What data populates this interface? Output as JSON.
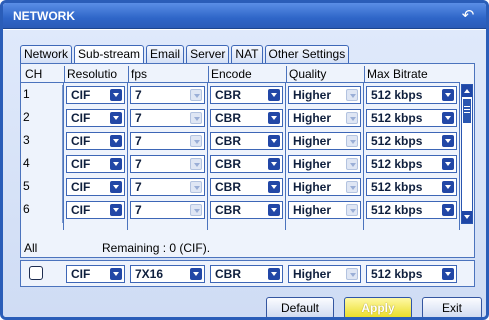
{
  "window": {
    "title": "NETWORK"
  },
  "tabs": [
    "Network",
    "Sub-stream",
    "Email",
    "Server",
    "NAT",
    "Other Settings"
  ],
  "active_tab": "Sub-stream",
  "table": {
    "headers": [
      "CH",
      "Resolutio",
      "fps",
      "Encode",
      "Quality",
      "Max Bitrate"
    ],
    "rows": [
      {
        "ch": "1",
        "resolution": "CIF",
        "fps": "7",
        "encode": "CBR",
        "quality": "Higher",
        "bitrate": "512 kbps"
      },
      {
        "ch": "2",
        "resolution": "CIF",
        "fps": "7",
        "encode": "CBR",
        "quality": "Higher",
        "bitrate": "512 kbps"
      },
      {
        "ch": "3",
        "resolution": "CIF",
        "fps": "7",
        "encode": "CBR",
        "quality": "Higher",
        "bitrate": "512 kbps"
      },
      {
        "ch": "4",
        "resolution": "CIF",
        "fps": "7",
        "encode": "CBR",
        "quality": "Higher",
        "bitrate": "512 kbps"
      },
      {
        "ch": "5",
        "resolution": "CIF",
        "fps": "7",
        "encode": "CBR",
        "quality": "Higher",
        "bitrate": "512 kbps"
      },
      {
        "ch": "6",
        "resolution": "CIF",
        "fps": "7",
        "encode": "CBR",
        "quality": "Higher",
        "bitrate": "512 kbps"
      }
    ]
  },
  "all": {
    "label": "All",
    "remaining": "Remaining : 0 (CIF).",
    "resolution": "CIF",
    "fps": "7X16",
    "encode": "CBR",
    "quality": "Higher",
    "bitrate": "512 kbps",
    "checked": false
  },
  "buttons": {
    "default": "Default",
    "apply": "Apply",
    "exit": "Exit"
  },
  "icons": {
    "back": "back-arrow-icon",
    "dropdown": "chevron-down-icon",
    "scroll_up": "scroll-up-icon",
    "scroll_down": "scroll-down-icon"
  },
  "colors": {
    "title_bar": "#2f66c8",
    "border": "#2a5db8",
    "arrow_button": "#2247a6",
    "apply_button": "#e9dc24",
    "panel_bg": "#dfe9fb"
  }
}
